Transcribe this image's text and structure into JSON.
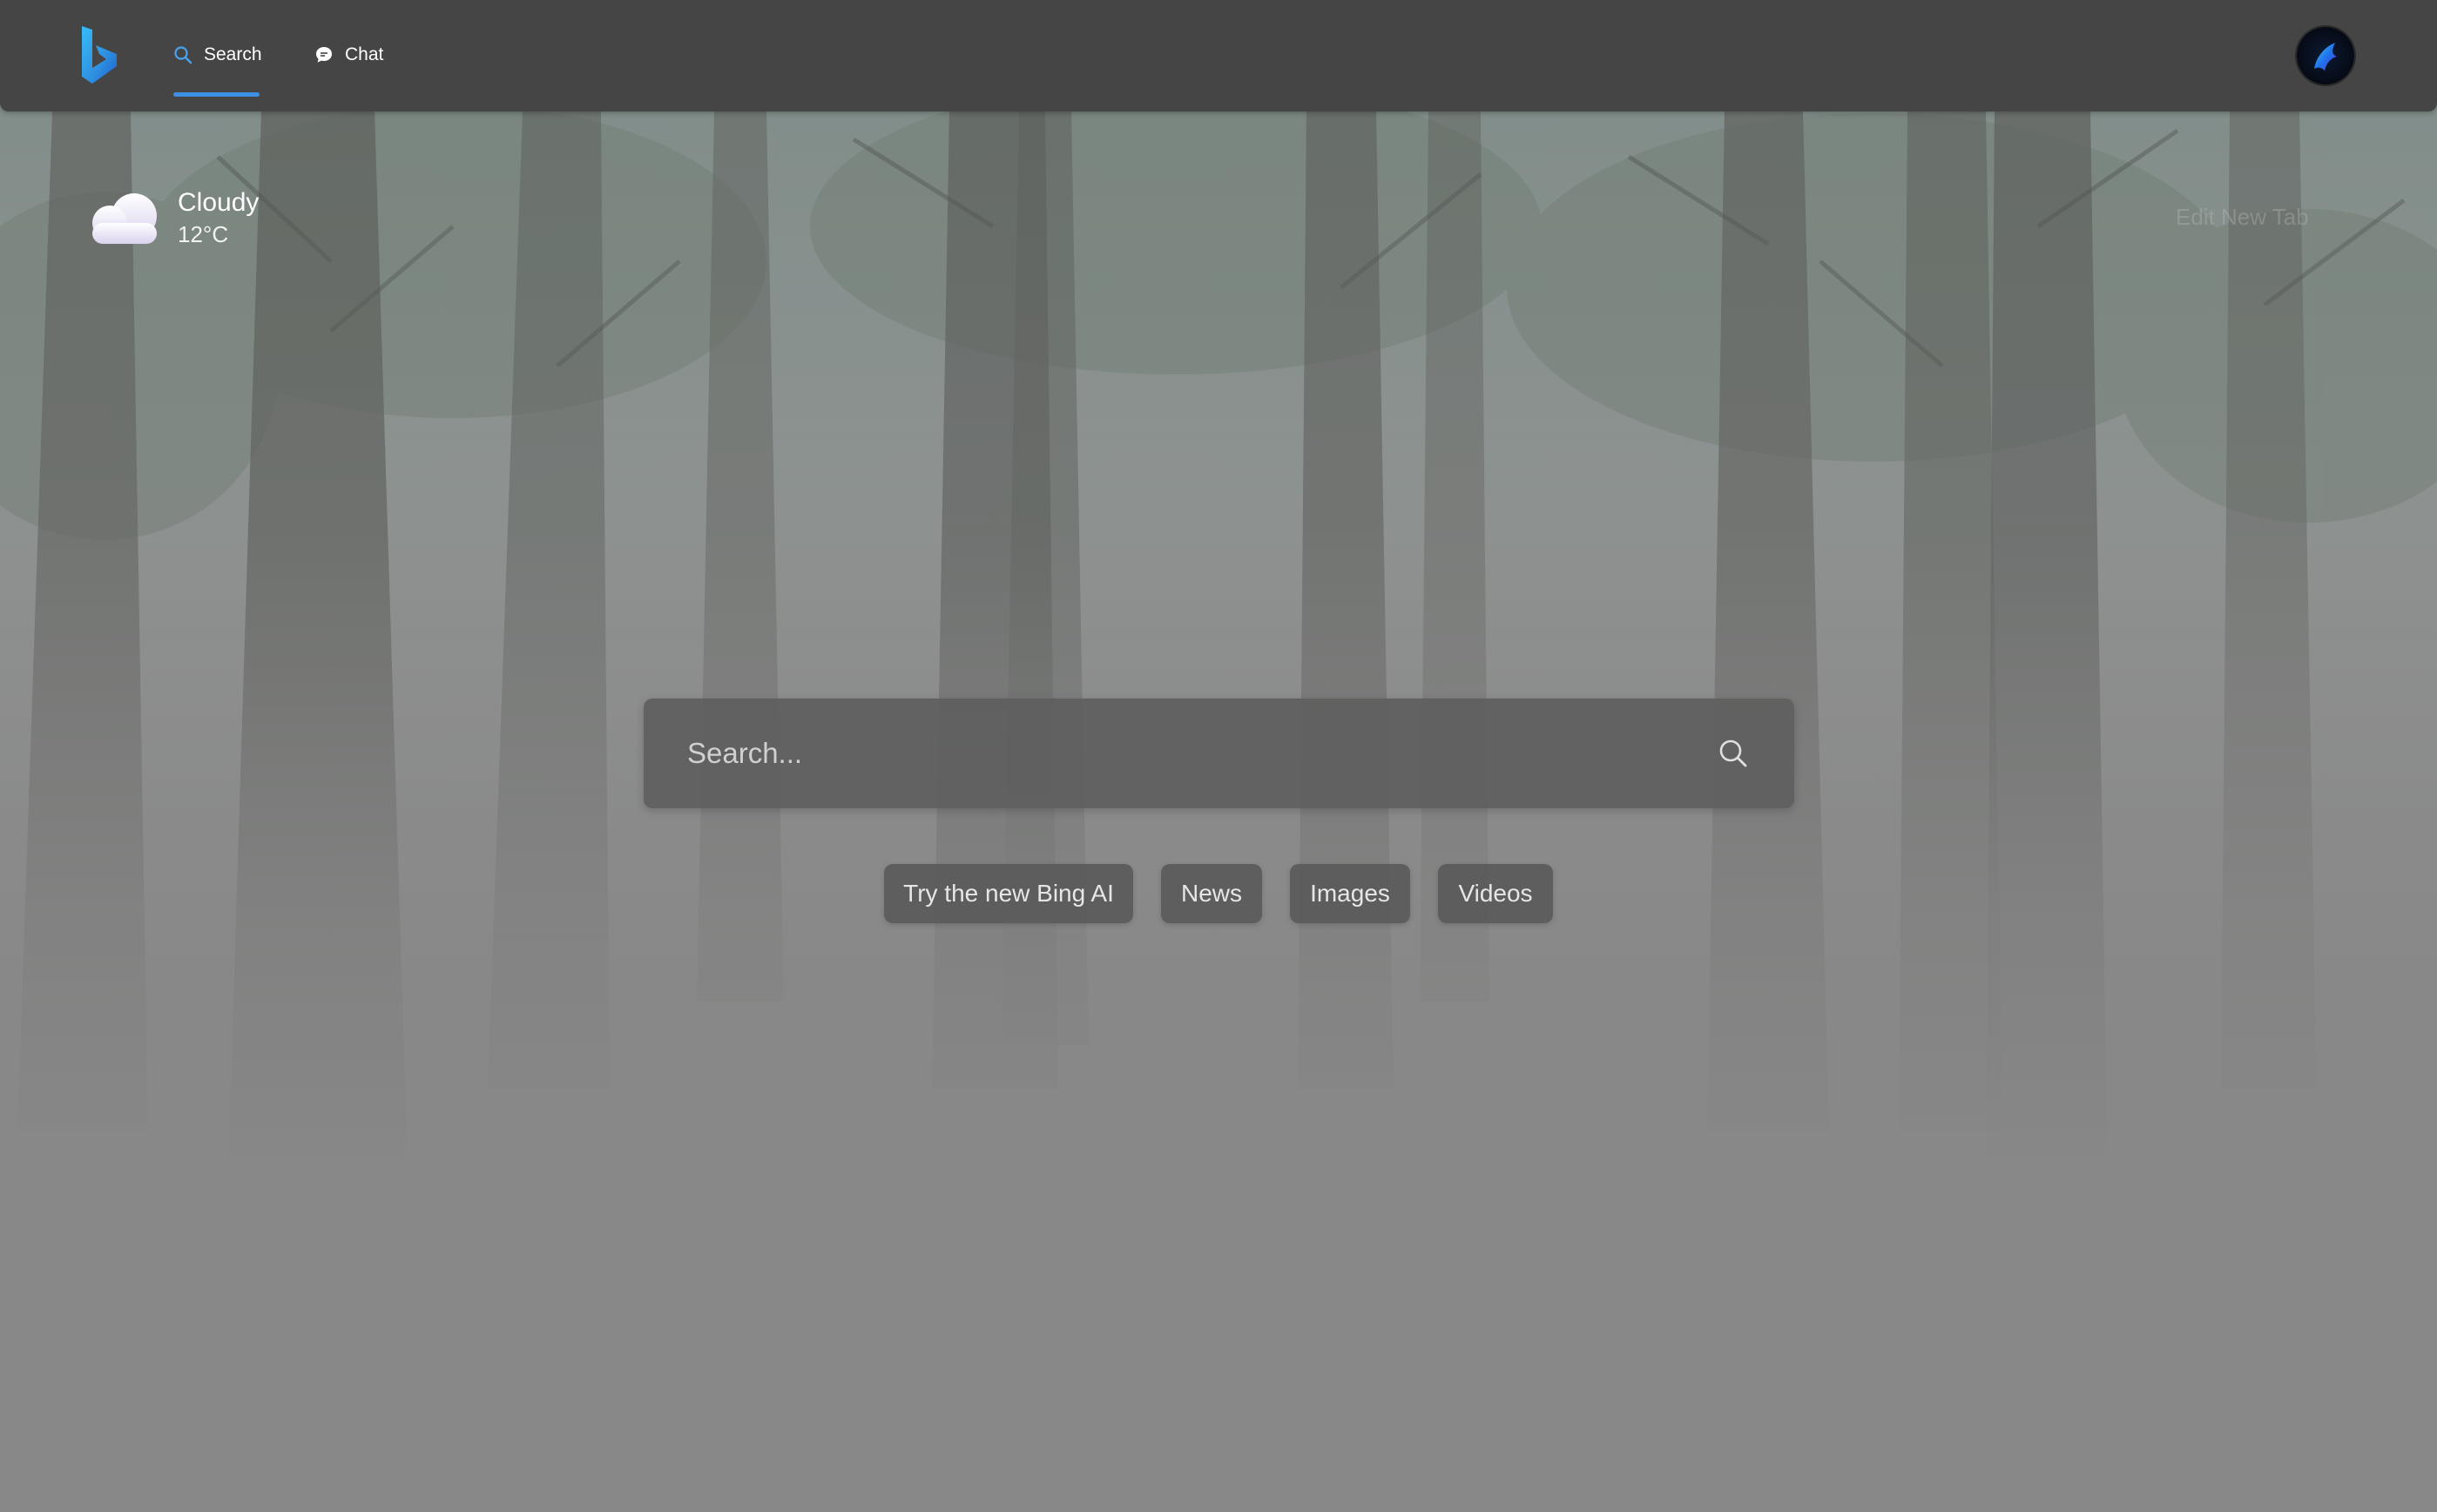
{
  "nav": {
    "tabs": [
      {
        "label": "Search",
        "icon": "search-icon",
        "active": true
      },
      {
        "label": "Chat",
        "icon": "chat-bubble-icon",
        "active": false
      }
    ],
    "logo": "bing-logo",
    "accent_color": "#3d8fe3",
    "avatar": "copilot-avatar"
  },
  "weather": {
    "condition": "Cloudy",
    "temperature": "12°C",
    "icon": "cloud-icon"
  },
  "edit_new_tab": {
    "label": "Edit New Tab"
  },
  "search": {
    "placeholder": "Search...",
    "value": "",
    "submit_icon": "search-icon"
  },
  "quick_links": [
    {
      "label": "Try the new Bing AI"
    },
    {
      "label": "News"
    },
    {
      "label": "Images"
    },
    {
      "label": "Videos"
    }
  ],
  "background": {
    "scene": "misty forest",
    "top_color": "#7f8c88",
    "bottom_color": "#878787"
  }
}
